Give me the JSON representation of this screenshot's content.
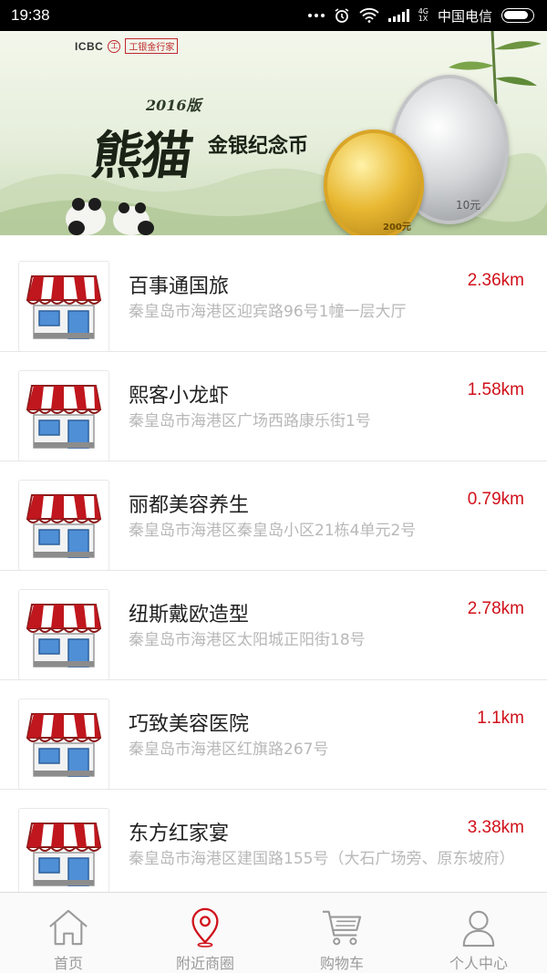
{
  "status_bar": {
    "time": "19:38",
    "network_top": "4G",
    "network_bottom": "1X",
    "carrier": "中国电信"
  },
  "banner": {
    "brand_logo": "ICBC",
    "brand_seal": "工",
    "brand_name": "工银金行家",
    "year": "2016版",
    "title_big": "熊猫",
    "title_sub": "金银纪念币",
    "coin_gold_value": "200元",
    "coin_silver_value": "10元"
  },
  "shops": [
    {
      "name": "百事通国旅",
      "distance": "2.36km",
      "address": "秦皇岛市海港区迎宾路96号1幢一层大厅"
    },
    {
      "name": "熙客小龙虾",
      "distance": "1.58km",
      "address": "秦皇岛市海港区广场西路康乐街1号"
    },
    {
      "name": "丽都美容养生",
      "distance": "0.79km",
      "address": "秦皇岛市海港区秦皇岛小区21栋4单元2号"
    },
    {
      "name": "纽斯戴欧造型",
      "distance": "2.78km",
      "address": "秦皇岛市海港区太阳城正阳街18号"
    },
    {
      "name": "巧致美容医院",
      "distance": "1.1km",
      "address": "秦皇岛市海港区红旗路267号"
    },
    {
      "name": "东方红家宴",
      "distance": "3.38km",
      "address": "秦皇岛市海港区建国路155号（大石广场旁、原东坡府）"
    }
  ],
  "nav": {
    "tabs": [
      {
        "label": "首页",
        "icon": "home-icon"
      },
      {
        "label": "附近商圈",
        "icon": "location-pin-icon",
        "active": true
      },
      {
        "label": "购物车",
        "icon": "shopping-cart-icon"
      },
      {
        "label": "个人中心",
        "icon": "user-icon"
      }
    ]
  },
  "colors": {
    "accent_red": "#d0111b",
    "nav_inactive": "#9a9a9a"
  }
}
